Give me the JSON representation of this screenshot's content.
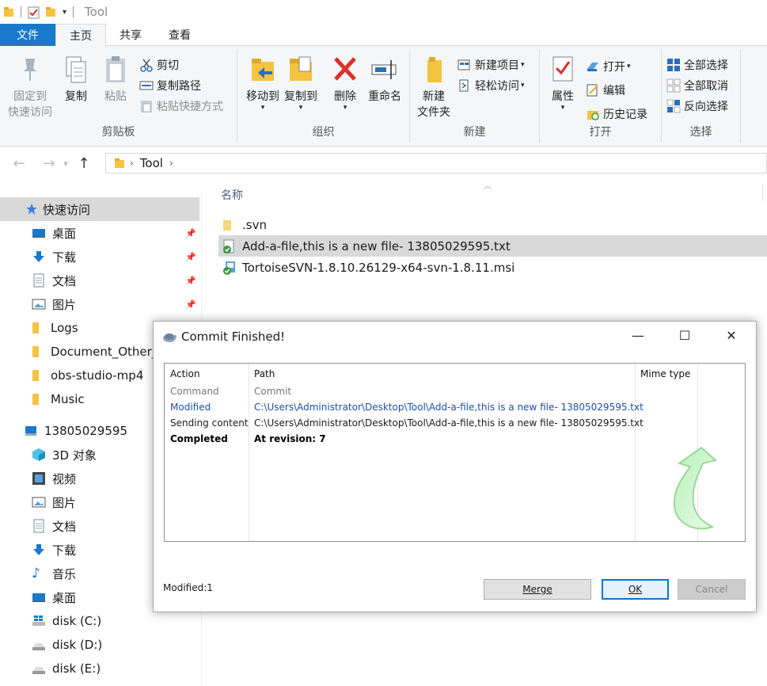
{
  "window": {
    "title": "Tool"
  },
  "ribbon": {
    "tabs": [
      {
        "label": "文件"
      },
      {
        "label": "主页"
      },
      {
        "label": "共享"
      },
      {
        "label": "查看"
      }
    ],
    "clipboard": {
      "group_label": "剪贴板",
      "pin_label_1": "固定到",
      "pin_label_2": "快速访问",
      "copy_label": "复制",
      "paste_label": "粘贴",
      "cut_label": "剪切",
      "copy_path_label": "复制路径",
      "paste_shortcut_label": "粘贴快捷方式"
    },
    "organize": {
      "group_label": "组织",
      "move_to_label": "移动到",
      "copy_to_label": "复制到",
      "delete_label": "删除",
      "rename_label": "重命名"
    },
    "new": {
      "group_label": "新建",
      "new_folder_label_1": "新建",
      "new_folder_label_2": "文件夹",
      "new_item_label": "新建项目",
      "easy_access_label": "轻松访问"
    },
    "open": {
      "group_label": "打开",
      "properties_label": "属性",
      "open_label": "打开",
      "edit_label": "编辑",
      "history_label": "历史记录"
    },
    "select": {
      "group_label": "选择",
      "select_all_label": "全部选择",
      "select_none_label": "全部取消",
      "invert_label": "反向选择"
    }
  },
  "address": {
    "path": "Tool"
  },
  "navpane": {
    "quick_access": "快速访问",
    "items": [
      {
        "label": "桌面"
      },
      {
        "label": "下载"
      },
      {
        "label": "文档"
      },
      {
        "label": "图片"
      },
      {
        "label": "Logs"
      },
      {
        "label": "Document_Other_"
      },
      {
        "label": "obs-studio-mp4"
      },
      {
        "label": "Music"
      }
    ],
    "this_pc": "13805029595",
    "pc_items": [
      {
        "label": "3D 对象"
      },
      {
        "label": "视频"
      },
      {
        "label": "图片"
      },
      {
        "label": "文档"
      },
      {
        "label": "下载"
      },
      {
        "label": "音乐"
      },
      {
        "label": "桌面"
      },
      {
        "label": "disk (C:)"
      },
      {
        "label": "disk (D:)"
      },
      {
        "label": "disk (E:)"
      }
    ]
  },
  "filelist": {
    "column_name": "名称",
    "files": [
      {
        "name": ".svn"
      },
      {
        "name": "Add-a-file,this is a new file- 13805029595.txt"
      },
      {
        "name": "TortoiseSVN-1.8.10.26129-x64-svn-1.8.11.msi"
      }
    ]
  },
  "dialog": {
    "title": "Commit Finished!",
    "columns": {
      "action": "Action",
      "path": "Path",
      "mime": "Mime type"
    },
    "rows": [
      {
        "action": "Command",
        "path": "Commit"
      },
      {
        "action": "Modified",
        "path": "C:\\Users\\Administrator\\Desktop\\Tool\\Add-a-file,this is a new file- 13805029595.txt"
      },
      {
        "action": "Sending content",
        "path": "C:\\Users\\Administrator\\Desktop\\Tool\\Add-a-file,this is a new file- 13805029595.txt"
      },
      {
        "action": "Completed",
        "path": "At revision: 7"
      }
    ],
    "status": "Modified:1",
    "merge_label": "Merge",
    "ok_label": "OK",
    "cancel_label": "Cancel"
  }
}
